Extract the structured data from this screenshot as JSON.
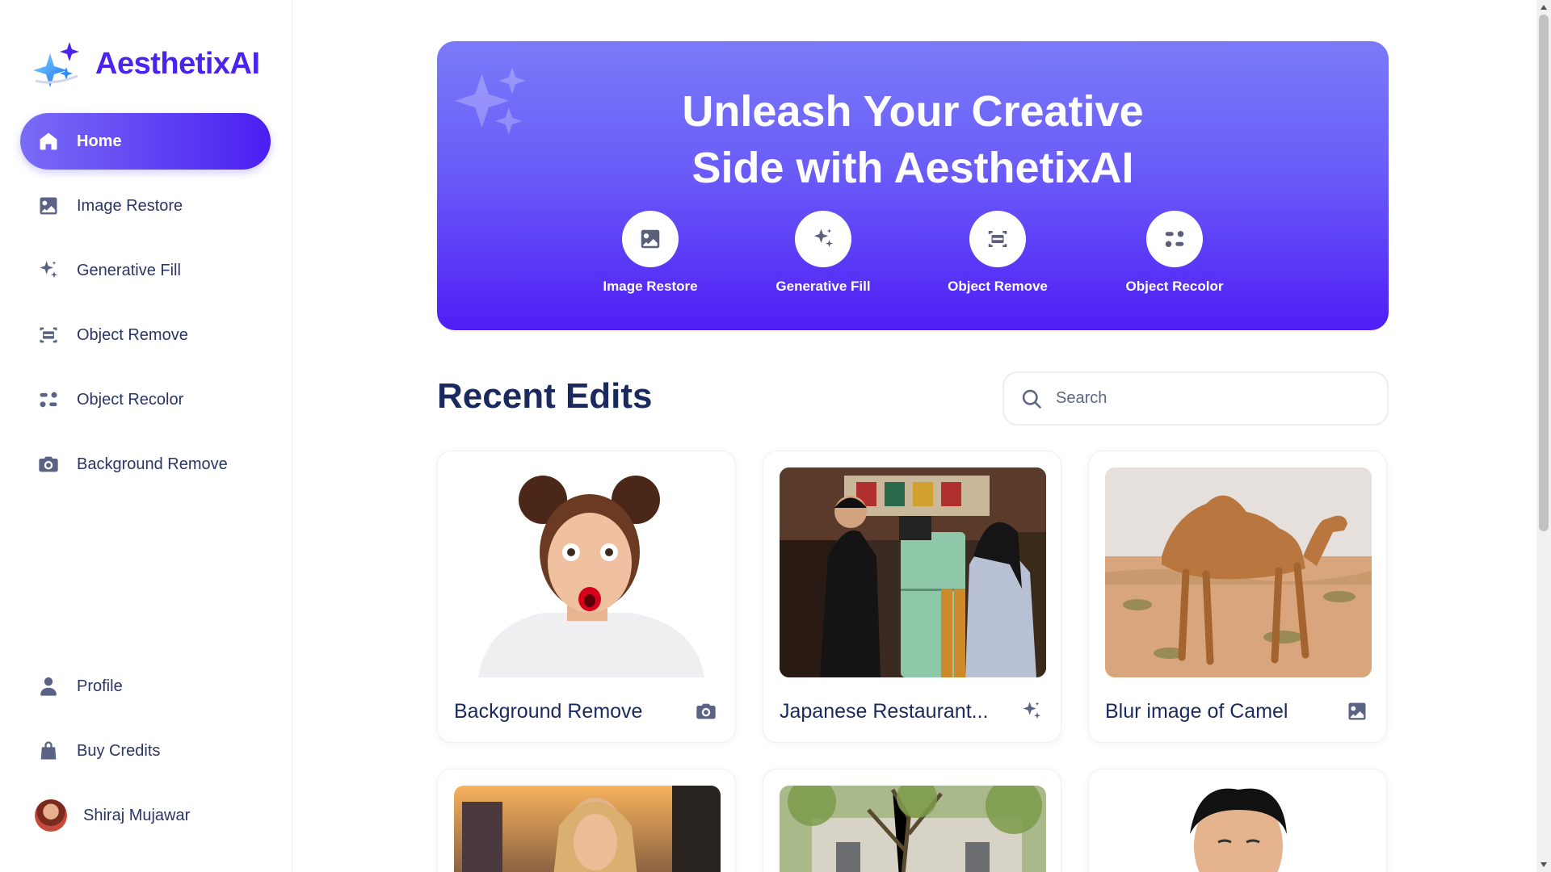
{
  "app": {
    "name": "AesthetixAI"
  },
  "sidebar": {
    "items": [
      {
        "label": "Home",
        "icon": "home-icon",
        "active": true
      },
      {
        "label": "Image Restore",
        "icon": "image-icon"
      },
      {
        "label": "Generative Fill",
        "icon": "sparkles-icon"
      },
      {
        "label": "Object Remove",
        "icon": "scan-icon"
      },
      {
        "label": "Object Recolor",
        "icon": "recolor-icon"
      },
      {
        "label": "Background Remove",
        "icon": "camera-icon"
      }
    ],
    "bottom": [
      {
        "label": "Profile",
        "icon": "user-icon"
      },
      {
        "label": "Buy Credits",
        "icon": "bag-icon"
      }
    ],
    "user": {
      "name": "Shiraj Mujawar"
    }
  },
  "hero": {
    "title_line1": "Unleash Your Creative",
    "title_line2": "Side with AesthetixAI",
    "actions": [
      {
        "label": "Image Restore",
        "icon": "image-icon"
      },
      {
        "label": "Generative Fill",
        "icon": "sparkles-icon"
      },
      {
        "label": "Object Remove",
        "icon": "scan-icon"
      },
      {
        "label": "Object Recolor",
        "icon": "recolor-icon"
      }
    ]
  },
  "recent": {
    "title": "Recent Edits",
    "search_placeholder": "Search",
    "cards": [
      {
        "title": "Background Remove",
        "icon": "camera-icon"
      },
      {
        "title": "Japanese Restaurant...",
        "icon": "sparkles-icon"
      },
      {
        "title": "Blur image of Camel",
        "icon": "image-icon"
      }
    ]
  },
  "colors": {
    "accent": "#4b22f0",
    "hero_start": "#7a7bf9",
    "hero_end": "#4f1ef6",
    "text": "#1b2a5e"
  }
}
